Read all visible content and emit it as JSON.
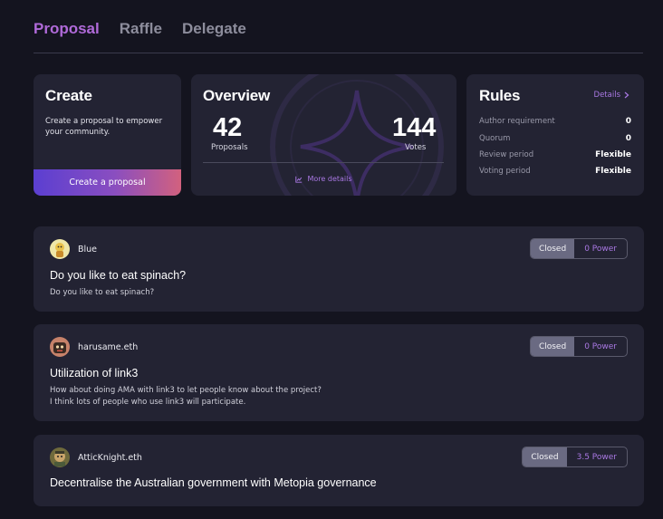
{
  "tabs": [
    "Proposal",
    "Raffle",
    "Delegate"
  ],
  "create": {
    "title": "Create",
    "description": "Create a proposal to empower your community.",
    "button": "Create a proposal"
  },
  "overview": {
    "title": "Overview",
    "proposals_count": "42",
    "proposals_label": "Proposals",
    "votes_count": "144",
    "votes_label": "Votes",
    "more": "More details",
    "more_icon": "chart-line-icon"
  },
  "rules": {
    "title": "Rules",
    "details": "Details",
    "rows": [
      {
        "label": "Author requirement",
        "value": "0"
      },
      {
        "label": "Quorum",
        "value": "0"
      },
      {
        "label": "Review period",
        "value": "Flexible"
      },
      {
        "label": "Voting period",
        "value": "Flexible"
      }
    ]
  },
  "proposals": [
    {
      "author": "Blue",
      "title": "Do you like to eat spinach?",
      "body": [
        "Do you like to eat spinach?"
      ],
      "status": "Closed",
      "power": "0 Power"
    },
    {
      "author": "harusame.eth",
      "title": "Utilization of link3",
      "body": [
        "How about doing AMA with link3 to let people know about the project?",
        "I think lots of people who use link3 will participate."
      ],
      "status": "Closed",
      "power": "0 Power"
    },
    {
      "author": "AtticKnight.eth",
      "title": "Decentralise the Australian government with Metopia governance",
      "body": [],
      "status": "Closed",
      "power": "3.5 Power"
    }
  ],
  "colors": {
    "accent": "#a978e3",
    "active_tab": "#b06ad9",
    "background": "#14141f",
    "card": "#232333"
  }
}
